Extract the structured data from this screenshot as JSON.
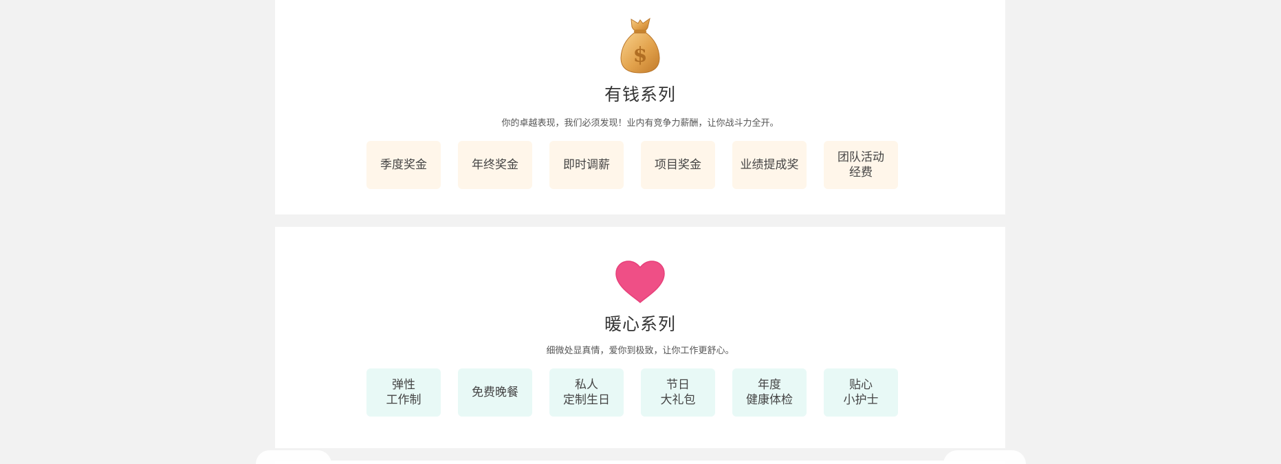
{
  "money_section": {
    "icon": "money-bag-icon",
    "title": "有钱系列",
    "subtitle": "你的卓越表现，我们必须发现！业内有竞争力薪酬，让你战斗力全开。",
    "accent": "#fff6ea",
    "items": [
      {
        "label": "季度奖金"
      },
      {
        "label": "年终奖金"
      },
      {
        "label": "即时调薪"
      },
      {
        "label": "项目奖金"
      },
      {
        "label": "业绩提成奖"
      },
      {
        "label": "团队活动\n经费"
      }
    ]
  },
  "heart_section": {
    "icon": "heart-icon",
    "title": "暖心系列",
    "subtitle": "细微处显真情，爱你到极致，让你工作更舒心。",
    "accent": "#e8f9f6",
    "heart_color": "#ef4f86",
    "items": [
      {
        "label": "弹性\n工作制"
      },
      {
        "label": "免费晚餐"
      },
      {
        "label": "私人\n定制生日"
      },
      {
        "label": "节日\n大礼包"
      },
      {
        "label": "年度\n健康体检"
      },
      {
        "label": "贴心\n小护士"
      }
    ]
  }
}
